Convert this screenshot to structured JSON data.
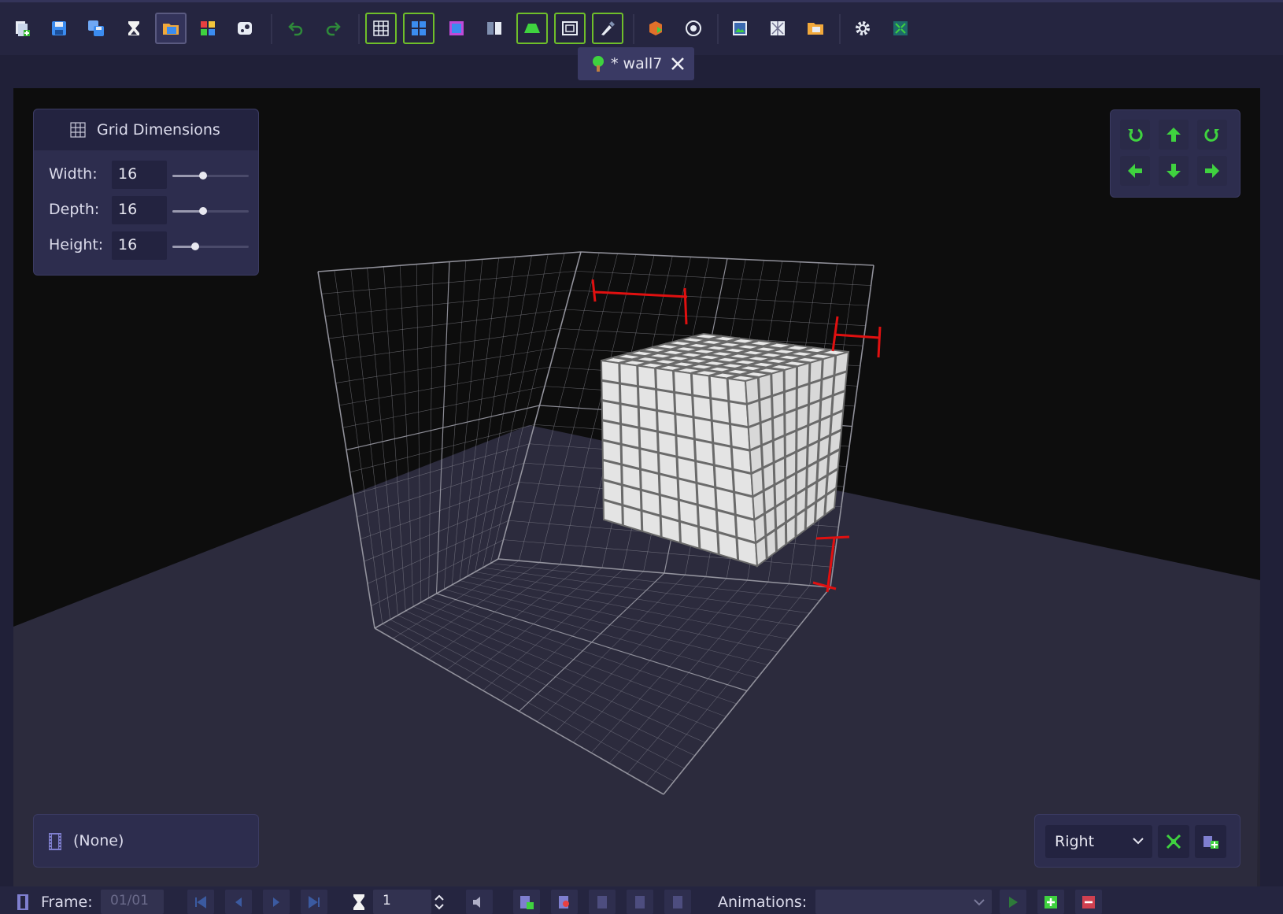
{
  "toolbar": {
    "buttons": [
      {
        "icon": "new-file-icon"
      },
      {
        "icon": "save-icon"
      },
      {
        "icon": "save-all-icon"
      },
      {
        "icon": "hourglass-icon"
      },
      {
        "icon": "open-folder-icon"
      },
      {
        "icon": "palette-icon"
      },
      {
        "icon": "steam-icon"
      },
      {
        "icon": "undo-icon"
      },
      {
        "icon": "redo-icon"
      },
      {
        "icon": "grid-icon"
      },
      {
        "icon": "grid-fill-icon"
      },
      {
        "icon": "square-icon"
      },
      {
        "icon": "mirror-icon"
      },
      {
        "icon": "floor-icon"
      },
      {
        "icon": "frame-icon"
      },
      {
        "icon": "paint-icon"
      },
      {
        "icon": "export-cube-icon"
      },
      {
        "icon": "camera-icon"
      },
      {
        "icon": "image-icon"
      },
      {
        "icon": "texture-icon"
      },
      {
        "icon": "folder-icon"
      },
      {
        "icon": "gear-icon"
      },
      {
        "icon": "fullscreen-icon"
      }
    ],
    "colors": {
      "active_border": "#6fbf2a",
      "accent_green": "#3fd23f",
      "accent_blue": "#3b8cf0"
    }
  },
  "tab": {
    "title": "* wall7",
    "icon": "tree-icon",
    "close_icon": "close-icon"
  },
  "grid_dimensions": {
    "title": "Grid Dimensions",
    "icon": "grid-icon",
    "fields": [
      {
        "label": "Width:",
        "value": "16",
        "level": 0.4
      },
      {
        "label": "Depth:",
        "value": "16",
        "level": 0.4
      },
      {
        "label": "Height:",
        "value": "16",
        "level": 0.3
      }
    ]
  },
  "nav": {
    "buttons": [
      {
        "icon": "rotate-left-icon"
      },
      {
        "icon": "arrow-up-icon"
      },
      {
        "icon": "rotate-right-icon"
      },
      {
        "icon": "arrow-left-icon"
      },
      {
        "icon": "arrow-down-icon"
      },
      {
        "icon": "arrow-right-icon"
      }
    ]
  },
  "animation_panel": {
    "icon": "film-icon",
    "label": "(None)"
  },
  "view_panel": {
    "selected": "Right",
    "buttons": [
      {
        "icon": "fit-view-icon"
      },
      {
        "icon": "add-view-icon"
      }
    ]
  },
  "bottom": {
    "frame_label": "Frame:",
    "frame_value": "01/01",
    "speed_value": "1",
    "animations_label": "Animations:",
    "animations_value": ""
  }
}
